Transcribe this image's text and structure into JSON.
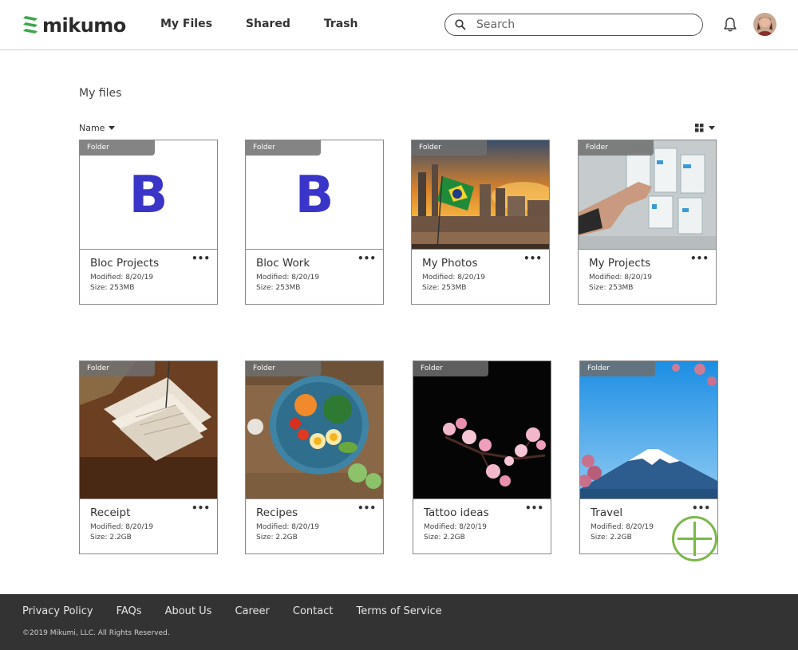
{
  "header": {
    "brand": "mikumo",
    "brand_color": "#3aa64a",
    "nav": [
      "My Files",
      "Shared",
      "Trash"
    ],
    "search_placeholder": "Search",
    "icons": {
      "search": "search-icon",
      "bell": "bell-icon",
      "avatar": "user-avatar"
    }
  },
  "main": {
    "title": "My files",
    "sort_label": "Name",
    "view": "grid",
    "folder_tag": "Folder",
    "cards": [
      {
        "tag": "Folder",
        "name": "Bloc Projects",
        "modified": "Modified: 8/20/19",
        "size": "Size: 253MB",
        "thumb_letter": "B"
      },
      {
        "tag": "Folder",
        "name": "Bloc Work",
        "modified": "Modified: 8/20/19",
        "size": "Size: 253MB",
        "thumb_letter": "B"
      },
      {
        "tag": "Folder",
        "name": "My Photos",
        "modified": "Modified: 8/20/19",
        "size": "Size: 253MB"
      },
      {
        "tag": "Folder",
        "name": "My Projects",
        "modified": "Modified: 8/20/19",
        "size": "Size: 253MB"
      },
      {
        "tag": "Folder",
        "name": "Receipt",
        "modified": "Modified: 8/20/19",
        "size": "Size: 2.2GB"
      },
      {
        "tag": "Folder",
        "name": "Recipes",
        "modified": "Modified: 8/20/19",
        "size": "Size: 2.2GB"
      },
      {
        "tag": "Folder",
        "name": "Tattoo ideas",
        "modified": "Modified: 8/20/19",
        "size": "Size: 2.2GB"
      },
      {
        "tag": "Folder",
        "name": "Travel",
        "modified": "Modified: 8/20/19",
        "size": "Size: 2.2GB"
      }
    ],
    "more_label": "•••",
    "accent_color": "#7bb84a",
    "letter_color": "#3a35c8"
  },
  "footer": {
    "links": [
      "Privacy Policy",
      "FAQs",
      "About Us",
      "Career",
      "Contact",
      "Terms of Service"
    ],
    "copyright": "©2019 Mikumi, LLC. All Rights Reserved."
  }
}
